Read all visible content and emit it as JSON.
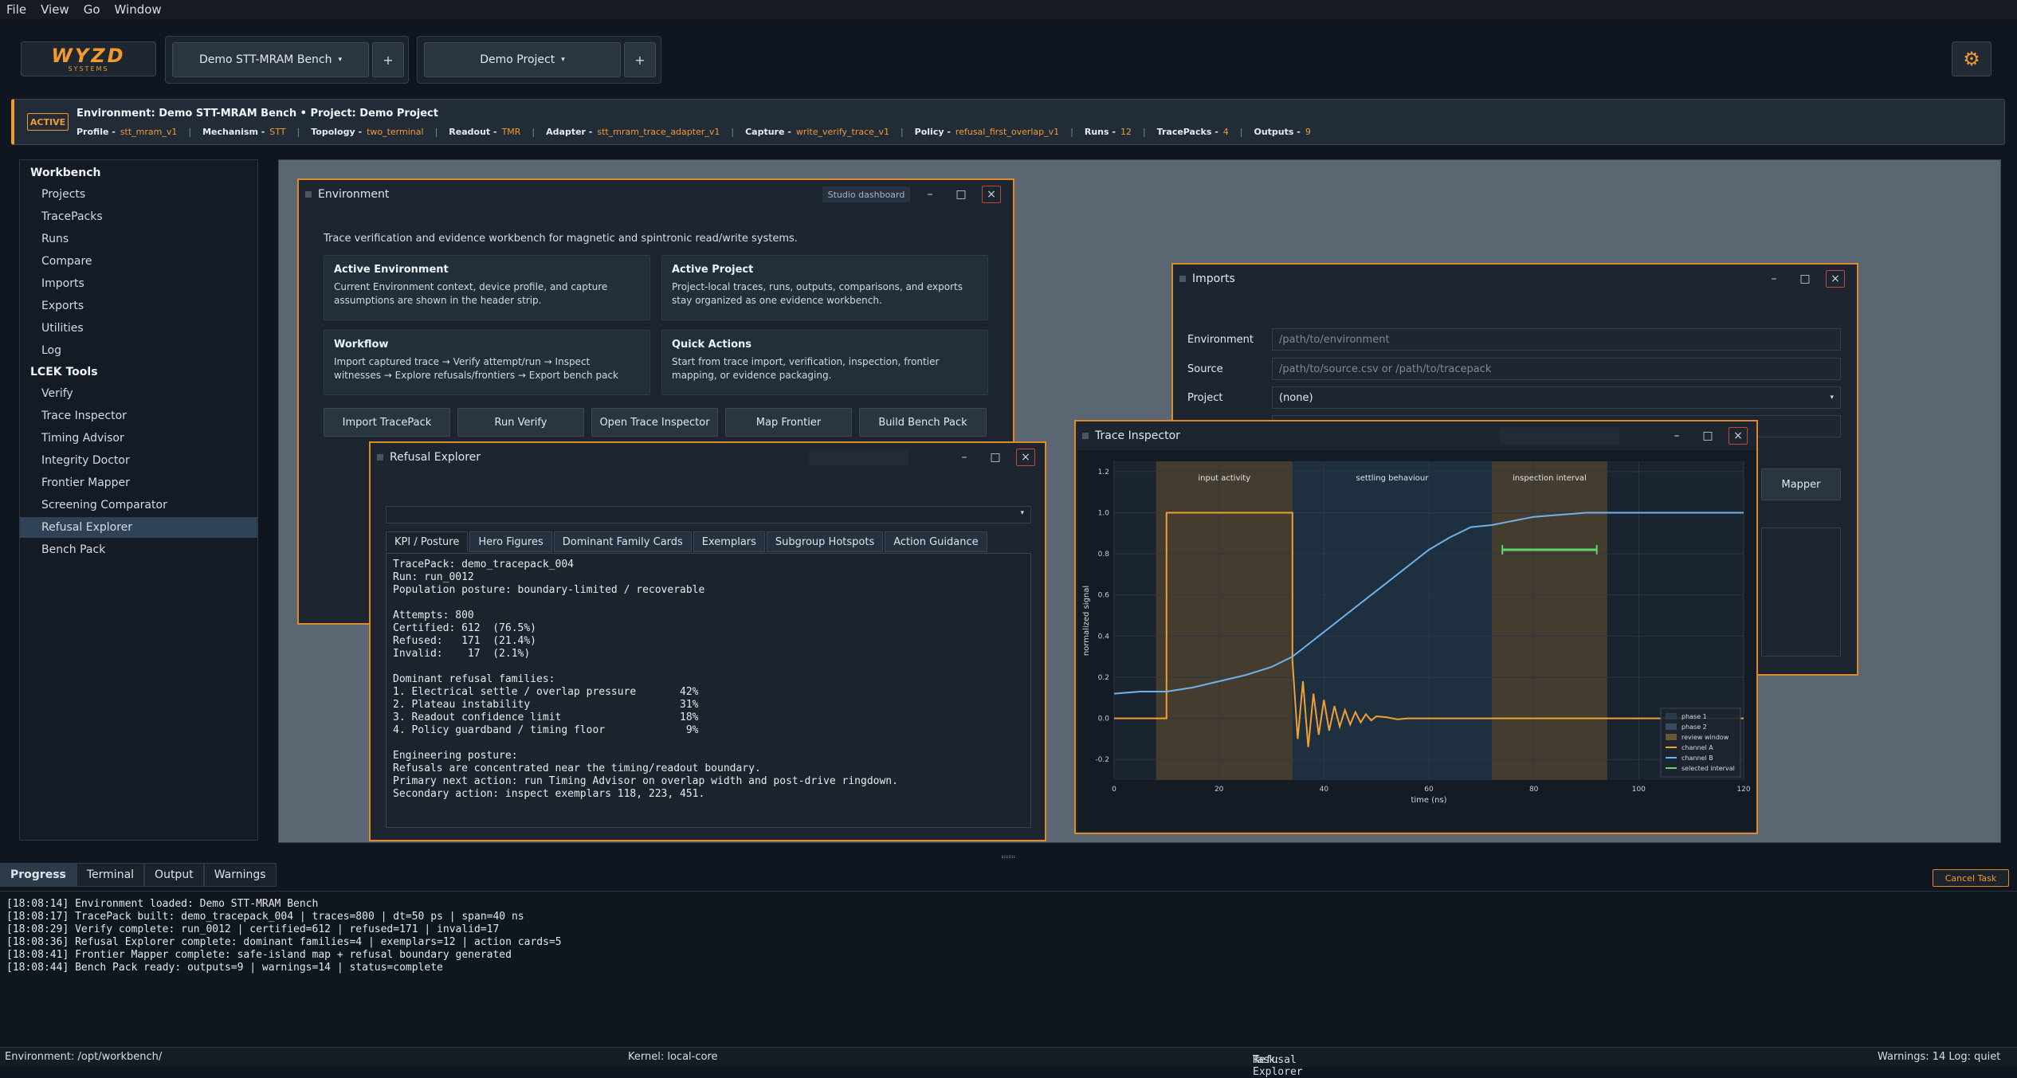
{
  "menu": [
    "File",
    "View",
    "Go",
    "Window"
  ],
  "logo": {
    "main": "WYZD",
    "sub": "SYSTEMS"
  },
  "header": {
    "env_select": "Demo STT-MRAM Bench",
    "project_select": "Demo Project",
    "caret": "▾",
    "plus": "+",
    "accent": "#f29a2e"
  },
  "strip": {
    "badge": "ACTIVE",
    "title": "Environment: Demo STT-MRAM Bench  •  Project: Demo Project",
    "items": [
      {
        "k": "Profile -",
        "v": "stt_mram_v1"
      },
      {
        "k": "Mechanism -",
        "v": "STT"
      },
      {
        "k": "Topology -",
        "v": "two_terminal"
      },
      {
        "k": "Readout -",
        "v": "TMR"
      },
      {
        "k": "Adapter -",
        "v": "stt_mram_trace_adapter_v1"
      },
      {
        "k": "Capture -",
        "v": "write_verify_trace_v1"
      },
      {
        "k": "Policy -",
        "v": "refusal_first_overlap_v1"
      },
      {
        "k": "Runs -",
        "v": "12"
      },
      {
        "k": "TracePacks -",
        "v": "4"
      },
      {
        "k": "Outputs -",
        "v": "9"
      }
    ]
  },
  "sidebar": {
    "workbench_title": "Workbench",
    "workbench": [
      "Projects",
      "TracePacks",
      "Runs",
      "Compare",
      "Imports",
      "Exports",
      "Utilities",
      "Log"
    ],
    "tools_title": "LCEK Tools",
    "tools": [
      "Verify",
      "Trace Inspector",
      "Timing Advisor",
      "Integrity Doctor",
      "Frontier Mapper",
      "Screening Comparator",
      "Refusal Explorer",
      "Bench Pack"
    ],
    "selected": "Refusal Explorer"
  },
  "env_window": {
    "title": "Environment",
    "dashboard": "Studio dashboard",
    "intro": "Trace verification and evidence workbench for magnetic and spintronic read/write systems.",
    "cards": [
      {
        "h": "Active Environment",
        "b": "Current Environment context, device profile, and capture assumptions are shown in the header strip."
      },
      {
        "h": "Active Project",
        "b": "Project-local traces, runs, outputs, comparisons, and exports stay organized as one evidence workbench."
      },
      {
        "h": "Workflow",
        "b": "Import captured trace → Verify attempt/run → Inspect witnesses → Explore refusals/frontiers → Export bench pack"
      },
      {
        "h": "Quick Actions",
        "b": "Start from trace import, verification, inspection, frontier mapping, or evidence packaging."
      }
    ],
    "actions": [
      "Import TracePack",
      "Run Verify",
      "Open Trace Inspector",
      "Map Frontier",
      "Build Bench Pack"
    ]
  },
  "imports_window": {
    "title": "Imports",
    "env_label": "Environment",
    "env_placeholder": "/path/to/environment",
    "source_label": "Source",
    "source_placeholder": "/path/to/source.csv or /path/to/tracepack",
    "project_label": "Project",
    "project_value": "(none)",
    "mapper_label": "Mapper"
  },
  "refusal_window": {
    "title": "Refusal Explorer",
    "tabs": [
      "KPI / Posture",
      "Hero Figures",
      "Dominant Family Cards",
      "Exemplars",
      "Subgroup Hotspots",
      "Action Guidance"
    ],
    "report": "TracePack: demo_tracepack_004\nRun: run_0012\nPopulation posture: boundary-limited / recoverable\n\nAttempts: 800\nCertified: 612  (76.5%)\nRefused:   171  (21.4%)\nInvalid:    17  (2.1%)\n\nDominant refusal families:\n1. Electrical settle / overlap pressure       42%\n2. Plateau instability                        31%\n3. Readout confidence limit                   18%\n4. Policy guardband / timing floor             9%\n\nEngineering posture:\nRefusals are concentrated near the timing/readout boundary.\nPrimary next action: run Timing Advisor on overlap width and post-drive ringdown.\nSecondary action: inspect exemplars 118, 223, 451."
  },
  "trace_window": {
    "title": "Trace Inspector"
  },
  "chart_data": {
    "type": "line",
    "title": "",
    "xlabel": "time (ns)",
    "ylabel": "normalized signal",
    "xlim": [
      0,
      120
    ],
    "ylim": [
      -0.3,
      1.25
    ],
    "xticks": [
      0,
      20,
      40,
      60,
      80,
      100,
      120
    ],
    "yticks": [
      -0.2,
      0.0,
      0.2,
      0.4,
      0.6,
      0.8,
      1.0,
      1.2
    ],
    "regions": [
      {
        "label": "input activity",
        "x0": 8,
        "x1": 34,
        "color": "#7a5a30"
      },
      {
        "label": "settling behaviour",
        "x0": 34,
        "x1": 72,
        "color": "#243d55"
      },
      {
        "label": "inspection interval",
        "x0": 72,
        "x1": 94,
        "color": "#7a5a30"
      }
    ],
    "series": [
      {
        "name": "channel A",
        "color": "#f0a030",
        "x": [
          0,
          10,
          10,
          34,
          34,
          35,
          36,
          37,
          38,
          39,
          40,
          41,
          42,
          43,
          44,
          45,
          46,
          47,
          48,
          49,
          50,
          52,
          54,
          56,
          60,
          70,
          80,
          90,
          100,
          120
        ],
        "y": [
          0,
          0,
          1,
          1,
          0.28,
          -0.1,
          0.18,
          -0.14,
          0.12,
          -0.08,
          0.09,
          -0.06,
          0.06,
          -0.04,
          0.04,
          -0.03,
          0.03,
          -0.02,
          0.02,
          -0.01,
          0.01,
          0.005,
          -0.005,
          0,
          0,
          0,
          0,
          0,
          0,
          0
        ]
      },
      {
        "name": "channel B",
        "color": "#6fb2ea",
        "x": [
          0,
          5,
          10,
          15,
          20,
          25,
          30,
          34,
          38,
          42,
          46,
          50,
          55,
          60,
          64,
          68,
          72,
          76,
          80,
          85,
          90,
          95,
          100,
          110,
          120
        ],
        "y": [
          0.12,
          0.13,
          0.13,
          0.15,
          0.18,
          0.21,
          0.25,
          0.3,
          0.38,
          0.46,
          0.54,
          0.62,
          0.72,
          0.82,
          0.88,
          0.93,
          0.94,
          0.96,
          0.98,
          0.99,
          1.0,
          1.0,
          1.0,
          1.0,
          1.0
        ]
      }
    ],
    "selected_interval": {
      "x0": 74,
      "x1": 92,
      "y": 0.82
    },
    "legend": [
      "phase 1",
      "phase 2",
      "review window",
      "channel A",
      "channel B",
      "selected interval"
    ],
    "legend_placement": "bottom-right"
  },
  "bottom": {
    "tabs": [
      "Progress",
      "Terminal",
      "Output",
      "Warnings"
    ],
    "cancel": "Cancel Task",
    "log": "[18:08:14] Environment loaded: Demo STT-MRAM Bench\n[18:08:17] TracePack built: demo_tracepack_004 | traces=800 | dt=50 ps | span=40 ns\n[18:08:29] Verify complete: run_0012 | certified=612 | refused=171 | invalid=17\n[18:08:36] Refusal Explorer complete: dominant families=4 | exemplars=12 | action cards=5\n[18:08:41] Frontier Mapper complete: safe-island map + refusal boundary generated\n[18:08:44] Bench Pack ready: outputs=9 | warnings=14 | status=complete"
  },
  "status": {
    "env": "Environment: /opt/workbench/",
    "kernel": "Kernel: local-core",
    "task_label": "Task: ",
    "task_value": "Refusal Explorer",
    "right": "Warnings: 14  Log: quiet"
  }
}
